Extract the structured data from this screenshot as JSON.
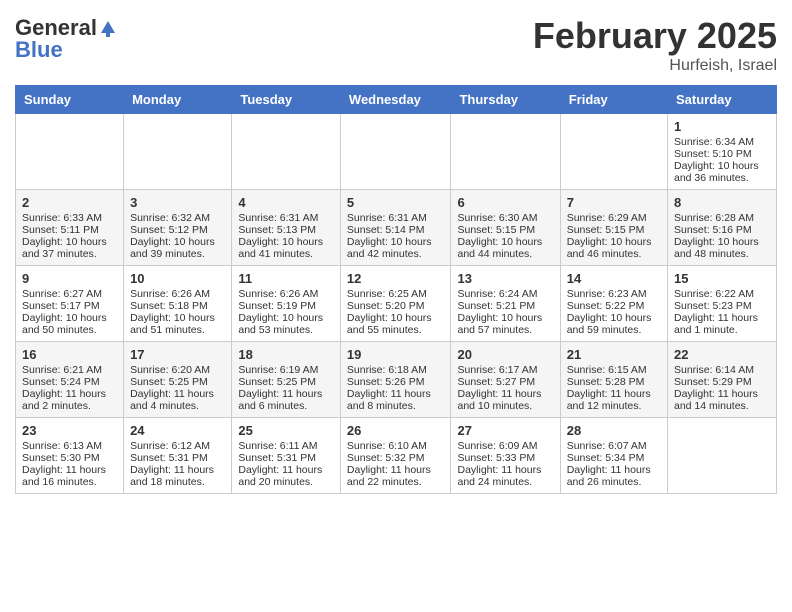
{
  "logo": {
    "general": "General",
    "blue": "Blue"
  },
  "header": {
    "month": "February 2025",
    "location": "Hurfeish, Israel"
  },
  "days": [
    "Sunday",
    "Monday",
    "Tuesday",
    "Wednesday",
    "Thursday",
    "Friday",
    "Saturday"
  ],
  "weeks": [
    [
      {
        "num": "",
        "info": ""
      },
      {
        "num": "",
        "info": ""
      },
      {
        "num": "",
        "info": ""
      },
      {
        "num": "",
        "info": ""
      },
      {
        "num": "",
        "info": ""
      },
      {
        "num": "",
        "info": ""
      },
      {
        "num": "1",
        "info": "Sunrise: 6:34 AM\nSunset: 5:10 PM\nDaylight: 10 hours and 36 minutes."
      }
    ],
    [
      {
        "num": "2",
        "info": "Sunrise: 6:33 AM\nSunset: 5:11 PM\nDaylight: 10 hours and 37 minutes."
      },
      {
        "num": "3",
        "info": "Sunrise: 6:32 AM\nSunset: 5:12 PM\nDaylight: 10 hours and 39 minutes."
      },
      {
        "num": "4",
        "info": "Sunrise: 6:31 AM\nSunset: 5:13 PM\nDaylight: 10 hours and 41 minutes."
      },
      {
        "num": "5",
        "info": "Sunrise: 6:31 AM\nSunset: 5:14 PM\nDaylight: 10 hours and 42 minutes."
      },
      {
        "num": "6",
        "info": "Sunrise: 6:30 AM\nSunset: 5:15 PM\nDaylight: 10 hours and 44 minutes."
      },
      {
        "num": "7",
        "info": "Sunrise: 6:29 AM\nSunset: 5:15 PM\nDaylight: 10 hours and 46 minutes."
      },
      {
        "num": "8",
        "info": "Sunrise: 6:28 AM\nSunset: 5:16 PM\nDaylight: 10 hours and 48 minutes."
      }
    ],
    [
      {
        "num": "9",
        "info": "Sunrise: 6:27 AM\nSunset: 5:17 PM\nDaylight: 10 hours and 50 minutes."
      },
      {
        "num": "10",
        "info": "Sunrise: 6:26 AM\nSunset: 5:18 PM\nDaylight: 10 hours and 51 minutes."
      },
      {
        "num": "11",
        "info": "Sunrise: 6:26 AM\nSunset: 5:19 PM\nDaylight: 10 hours and 53 minutes."
      },
      {
        "num": "12",
        "info": "Sunrise: 6:25 AM\nSunset: 5:20 PM\nDaylight: 10 hours and 55 minutes."
      },
      {
        "num": "13",
        "info": "Sunrise: 6:24 AM\nSunset: 5:21 PM\nDaylight: 10 hours and 57 minutes."
      },
      {
        "num": "14",
        "info": "Sunrise: 6:23 AM\nSunset: 5:22 PM\nDaylight: 10 hours and 59 minutes."
      },
      {
        "num": "15",
        "info": "Sunrise: 6:22 AM\nSunset: 5:23 PM\nDaylight: 11 hours and 1 minute."
      }
    ],
    [
      {
        "num": "16",
        "info": "Sunrise: 6:21 AM\nSunset: 5:24 PM\nDaylight: 11 hours and 2 minutes."
      },
      {
        "num": "17",
        "info": "Sunrise: 6:20 AM\nSunset: 5:25 PM\nDaylight: 11 hours and 4 minutes."
      },
      {
        "num": "18",
        "info": "Sunrise: 6:19 AM\nSunset: 5:25 PM\nDaylight: 11 hours and 6 minutes."
      },
      {
        "num": "19",
        "info": "Sunrise: 6:18 AM\nSunset: 5:26 PM\nDaylight: 11 hours and 8 minutes."
      },
      {
        "num": "20",
        "info": "Sunrise: 6:17 AM\nSunset: 5:27 PM\nDaylight: 11 hours and 10 minutes."
      },
      {
        "num": "21",
        "info": "Sunrise: 6:15 AM\nSunset: 5:28 PM\nDaylight: 11 hours and 12 minutes."
      },
      {
        "num": "22",
        "info": "Sunrise: 6:14 AM\nSunset: 5:29 PM\nDaylight: 11 hours and 14 minutes."
      }
    ],
    [
      {
        "num": "23",
        "info": "Sunrise: 6:13 AM\nSunset: 5:30 PM\nDaylight: 11 hours and 16 minutes."
      },
      {
        "num": "24",
        "info": "Sunrise: 6:12 AM\nSunset: 5:31 PM\nDaylight: 11 hours and 18 minutes."
      },
      {
        "num": "25",
        "info": "Sunrise: 6:11 AM\nSunset: 5:31 PM\nDaylight: 11 hours and 20 minutes."
      },
      {
        "num": "26",
        "info": "Sunrise: 6:10 AM\nSunset: 5:32 PM\nDaylight: 11 hours and 22 minutes."
      },
      {
        "num": "27",
        "info": "Sunrise: 6:09 AM\nSunset: 5:33 PM\nDaylight: 11 hours and 24 minutes."
      },
      {
        "num": "28",
        "info": "Sunrise: 6:07 AM\nSunset: 5:34 PM\nDaylight: 11 hours and 26 minutes."
      },
      {
        "num": "",
        "info": ""
      }
    ]
  ]
}
